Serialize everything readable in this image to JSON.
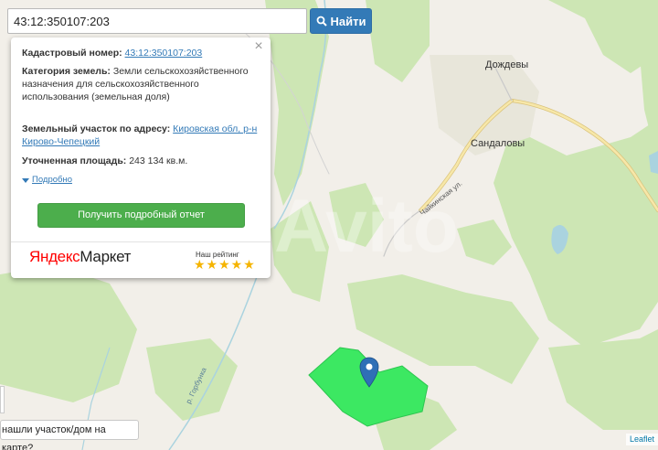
{
  "search": {
    "value": "43:12:350107:203",
    "button_label": "Найти",
    "icon": "search-icon"
  },
  "popup": {
    "close_glyph": "×",
    "cadastral_label": "Кадастровый номер:",
    "cadastral_value": "43:12:350107:203",
    "category_label": "Категория земель:",
    "category_value": "Земли сельскохозяйственного назначения",
    "category_value_2": "для сельскохозяйственного использования (земельная доля)",
    "address_label": "Земельный участок по адресу:",
    "address_value": "Кировская обл, р-н Кирово-Чепецкий",
    "area_label": "Уточненная площадь:",
    "area_value": "243 134 кв.м.",
    "more_label": "Подробно",
    "report_button": "Получить подробный отчет",
    "ym_logo_ya": "Яндекс",
    "ym_logo_rest": "Маркет",
    "rating_title": "Наш рейтинг",
    "rating_stars": "★★★★★",
    "rating_value": 5
  },
  "map": {
    "labels": {
      "village_1": "Дождевы",
      "village_2": "Сандаловы",
      "street_1": "Чайкинская ул.",
      "river_1": "р. Горбунка"
    },
    "colors": {
      "base": "#f2efe9",
      "forest": "#c8e6b0",
      "parcel": "#3ce862",
      "road": "#f7e7a8",
      "road_edge": "#d9c27a",
      "marker": "#2f6fb6"
    },
    "watermark": "Avito"
  },
  "help_button": "нашли участок/дом на карте?",
  "attribution": "Leaflet"
}
